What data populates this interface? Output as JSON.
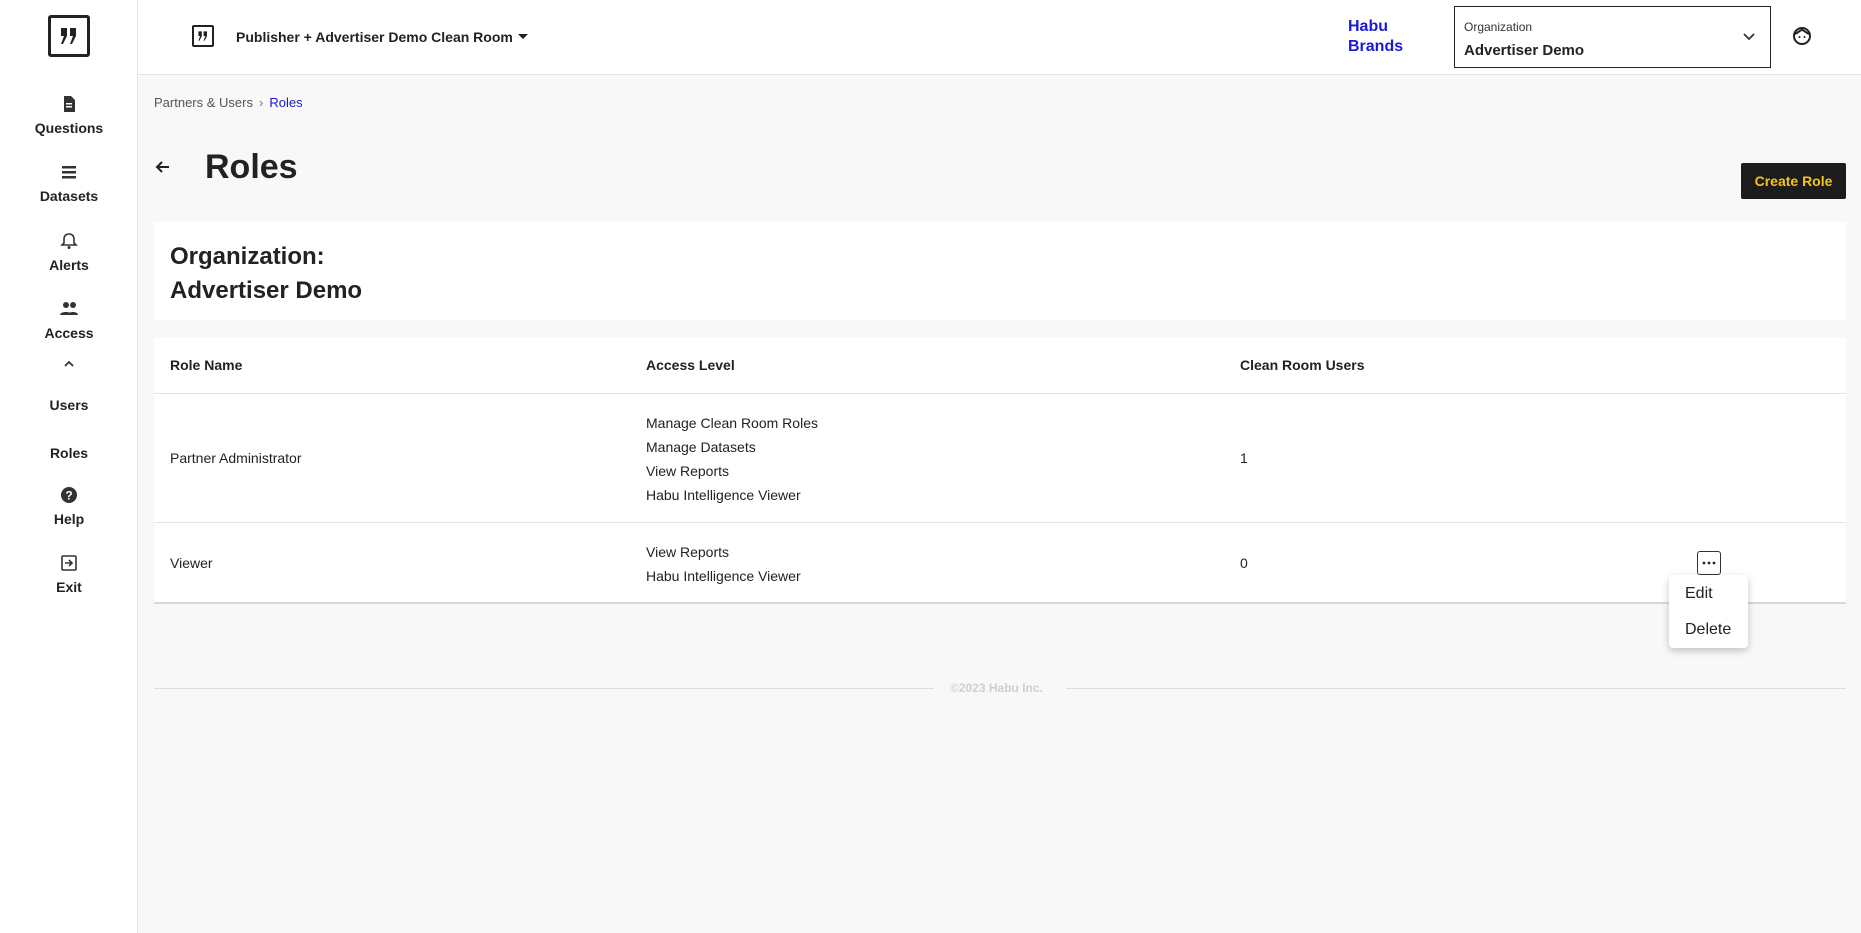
{
  "sidebar": {
    "items": [
      {
        "label": "Questions",
        "icon": "document-icon"
      },
      {
        "label": "Datasets",
        "icon": "list-icon"
      },
      {
        "label": "Alerts",
        "icon": "bell-icon"
      },
      {
        "label": "Access",
        "icon": "people-icon"
      },
      {
        "label": "Help",
        "icon": "help-icon"
      },
      {
        "label": "Exit",
        "icon": "exit-icon"
      }
    ],
    "access_subitems": [
      "Users",
      "Roles"
    ]
  },
  "topbar": {
    "clean_room": "Publisher + Advertiser Demo Clean Room",
    "brand": "Habu Brands",
    "org_select_label": "Organization",
    "org_select_value": "Advertiser Demo"
  },
  "breadcrumb": {
    "parent": "Partners & Users",
    "separator": "›",
    "current": "Roles"
  },
  "page": {
    "title": "Roles",
    "create_button": "Create Role"
  },
  "org_card": {
    "label": "Organization:",
    "name": "Advertiser Demo"
  },
  "table": {
    "headers": [
      "Role Name",
      "Access Level",
      "Clean Room Users"
    ],
    "rows": [
      {
        "role": "Partner Administrator",
        "access": [
          "Manage Clean Room Roles",
          "Manage Datasets",
          "View Reports",
          "Habu Intelligence Viewer"
        ],
        "users": "1"
      },
      {
        "role": "Viewer",
        "access": [
          "View Reports",
          "Habu Intelligence Viewer"
        ],
        "users": "0"
      }
    ]
  },
  "row_menu": {
    "items": [
      "Edit",
      "Delete"
    ]
  },
  "footer": {
    "copyright": "©2023 Habu Inc."
  },
  "colors": {
    "accent_link": "#1a1ad6",
    "button_bg": "#1c1c1c",
    "button_text": "#f5c518"
  }
}
